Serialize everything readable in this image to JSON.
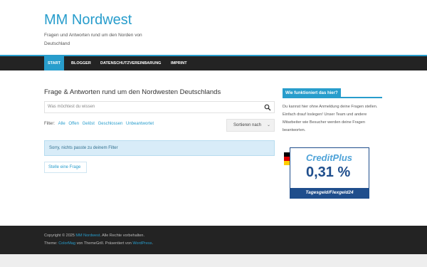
{
  "header": {
    "site_title": "MM Nordwest",
    "tagline": "Fragen und Antworten rund um den Norden von Deutschland"
  },
  "nav": {
    "items": [
      {
        "label": "START",
        "active": true
      },
      {
        "label": "BLOGGER",
        "active": false
      },
      {
        "label": "DATENSCHUTZVEREINBARUNG",
        "active": false
      },
      {
        "label": "IMPRINT",
        "active": false
      }
    ]
  },
  "main": {
    "title": "Frage & Antworten rund um den Nordwesten Deutschlands",
    "search": {
      "placeholder": "Was möchtest du wissen",
      "icon": "search-icon"
    },
    "filter": {
      "label": "Filter:",
      "options": [
        "Alle",
        "Offen",
        "Gelöst",
        "Geschlossen",
        "Unbeantwortet"
      ]
    },
    "sort": {
      "label": "Sortieren nach",
      "icon": "chevron-down-icon"
    },
    "notice": "Sorry, nichts passte zu deinem Filter",
    "ask_button": "Stelle eine Frage"
  },
  "sidebar": {
    "widget_title": "Wie funktioniert das hier?",
    "widget_text": "Du kannst  hier ohne Anmeldung deine Fragen stellen. Einfach drauf loslegen! Unser Team und andere Mitarbeiter wie Besucher werden deine Fragen beantworten.",
    "ad": {
      "brand": "CreditPlus",
      "rate": "0,31 %",
      "product": "Tagesgeld/Flexgeld24"
    }
  },
  "footer": {
    "copyright_prefix": "Copyright © 2025",
    "copyright_link": "MM Nordwest",
    "copyright_suffix": ". Alle Rechte vorbehalten.",
    "theme_prefix": "Theme:",
    "theme_link": "ColorMag",
    "theme_middle": "von ThemeGrill. Präsentiert von",
    "wp_link": "WordPress",
    "theme_suffix": "."
  },
  "colors": {
    "accent": "#289dcc",
    "nav_bg": "#232323",
    "notice_bg": "#d8ecf8",
    "brand_dark": "#1f4e8c"
  }
}
